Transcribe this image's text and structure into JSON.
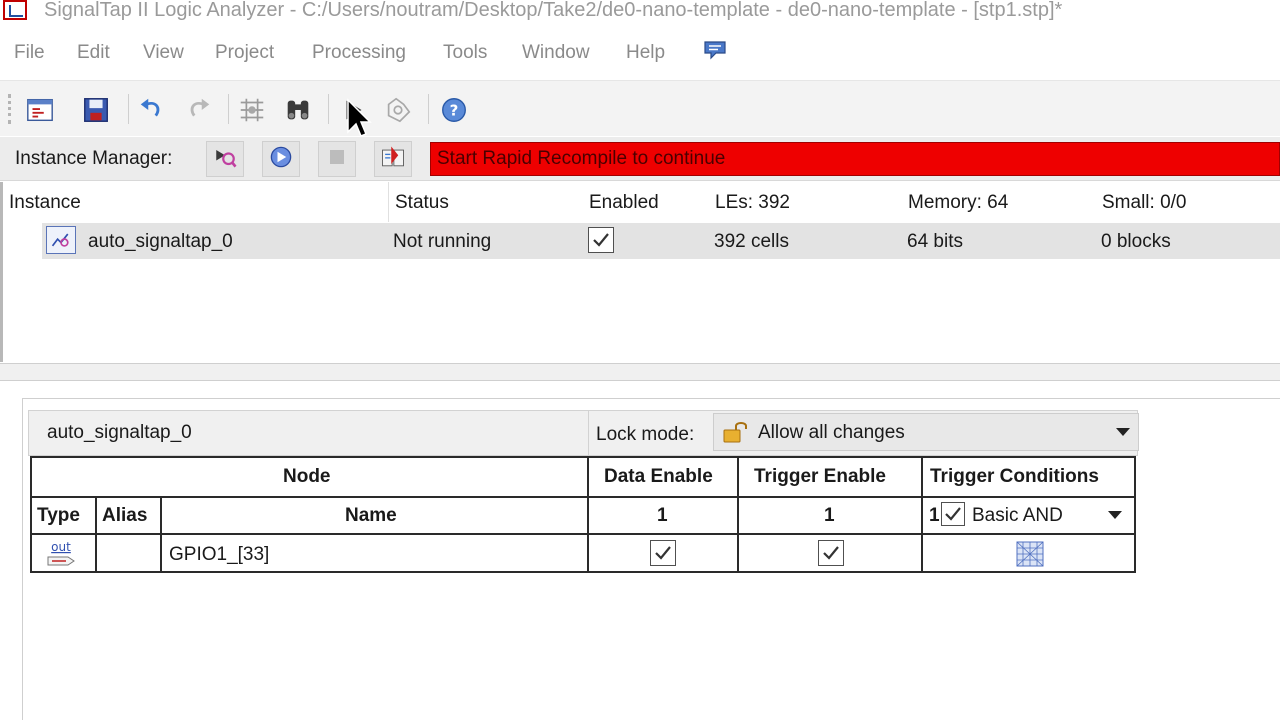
{
  "window": {
    "title": "SignalTap II Logic Analyzer - C:/Users/noutram/Desktop/Take2/de0-nano-template - de0-nano-template - [stp1.stp]*",
    "app_icon": "signaltap-app-icon"
  },
  "menu": {
    "items": [
      "File",
      "Edit",
      "View",
      "Project",
      "Processing",
      "Tools",
      "Window",
      "Help"
    ],
    "chat_icon": "comment-icon"
  },
  "toolbar": {
    "icons": [
      "setup-icon",
      "save-icon",
      "undo-icon",
      "redo-icon",
      "node-finder-icon",
      "binoculars-icon",
      "run-analysis-icon",
      "autorun-icon",
      "help-icon"
    ]
  },
  "instance_manager": {
    "label": "Instance Manager:",
    "status_message": "Start Rapid Recompile to continue",
    "status_color": "#ee0000",
    "buttons": [
      "run-analysis-icon",
      "autorun-analysis-icon",
      "stop-analysis-icon",
      "read-data-icon"
    ]
  },
  "instance_table": {
    "headers": {
      "instance": "Instance",
      "status": "Status",
      "enabled": "Enabled",
      "les": "LEs: 392",
      "memory": "Memory: 64",
      "small": "Small: 0/0"
    },
    "rows": [
      {
        "instance": "auto_signaltap_0",
        "status": "Not running",
        "enabled": true,
        "les": "392 cells",
        "memory": "64 bits",
        "small": "0 blocks"
      }
    ]
  },
  "node_panel": {
    "instance_name": "auto_signaltap_0",
    "lock_mode_label": "Lock mode:",
    "lock_mode_value": "Allow all changes",
    "headers": {
      "node": "Node",
      "data_enable": "Data Enable",
      "trigger_enable": "Trigger Enable",
      "trigger_conditions": "Trigger Conditions",
      "type": "Type",
      "alias": "Alias",
      "name": "Name",
      "data_enable_count": "1",
      "trigger_enable_count": "1",
      "trigger_condition_index": "1",
      "trigger_condition_mode": "Basic AND"
    },
    "rows": [
      {
        "type_label": "out",
        "alias": "",
        "name": "GPIO1_[33]",
        "data_enable": true,
        "trigger_enable": true,
        "trigger_condition": "dont-care-pattern-icon"
      }
    ]
  }
}
